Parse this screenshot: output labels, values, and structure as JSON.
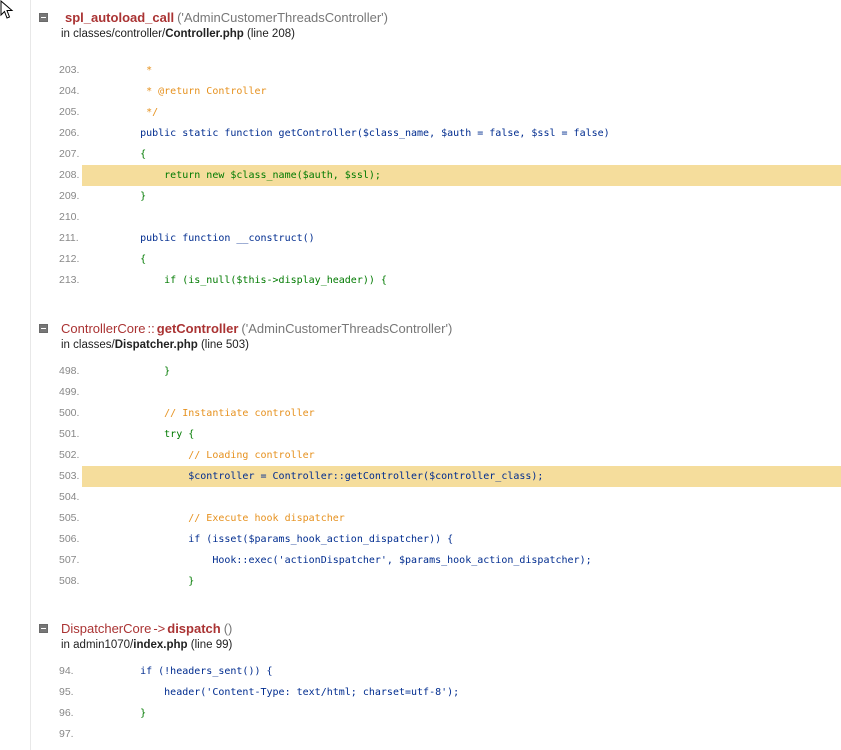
{
  "frames": [
    {
      "class": "",
      "operator": "",
      "function": "spl_autoload_call",
      "args": "('AdminCustomerThreadsController')",
      "location_prefix": "in ",
      "dir": "classes/controller/",
      "file": "Controller.php",
      "line_info": " (line 208)",
      "lines": [
        {
          "no": "203.",
          "code": "     *",
          "type": "com"
        },
        {
          "no": "204.",
          "code": "     * @return Controller",
          "type": "com"
        },
        {
          "no": "205.",
          "code": "     */",
          "type": "com"
        },
        {
          "no": "206.",
          "code": "    public static function getController($class_name, $auth = false, $ssl = false)",
          "type": "def"
        },
        {
          "no": "207.",
          "code": "    {",
          "type": "kw"
        },
        {
          "no": "208.",
          "code": "        return new $class_name($auth, $ssl);",
          "type": "kw",
          "highlight": true
        },
        {
          "no": "209.",
          "code": "    }",
          "type": "kw"
        },
        {
          "no": "210.",
          "code": "",
          "type": "kw"
        },
        {
          "no": "211.",
          "code": "    public function __construct()",
          "type": "def"
        },
        {
          "no": "212.",
          "code": "    {",
          "type": "kw"
        },
        {
          "no": "213.",
          "code": "        if (is_null($this->display_header)) {",
          "type": "kw"
        }
      ]
    },
    {
      "class": "ControllerCore",
      "operator": "::",
      "function": "getController",
      "args": "('AdminCustomerThreadsController')",
      "location_prefix": "in ",
      "dir": "classes/",
      "file": "Dispatcher.php",
      "line_info": " (line 503)",
      "lines": [
        {
          "no": "498.",
          "code": "        }",
          "type": "kw"
        },
        {
          "no": "499.",
          "code": "",
          "type": "kw"
        },
        {
          "no": "500.",
          "code": "        // Instantiate controller",
          "type": "com"
        },
        {
          "no": "501.",
          "code": "        try {",
          "type": "kw"
        },
        {
          "no": "502.",
          "code": "            // Loading controller",
          "type": "com"
        },
        {
          "no": "503.",
          "code": "            $controller = Controller::getController($controller_class);",
          "type": "def",
          "highlight": true
        },
        {
          "no": "504.",
          "code": "",
          "type": "kw"
        },
        {
          "no": "505.",
          "code": "            // Execute hook dispatcher",
          "type": "com"
        },
        {
          "no": "506.",
          "code": "            if (isset($params_hook_action_dispatcher)) {",
          "type": "def"
        },
        {
          "no": "507.",
          "code": "                Hook::exec('actionDispatcher', $params_hook_action_dispatcher);",
          "type": "def"
        },
        {
          "no": "508.",
          "code": "            }",
          "type": "kw"
        }
      ]
    },
    {
      "class": "DispatcherCore",
      "operator": "->",
      "function": "dispatch",
      "args": "()",
      "location_prefix": "in ",
      "dir": "admin1070/",
      "file": "index.php",
      "line_info": " (line 99)",
      "lines": [
        {
          "no": "94.",
          "code": "    if (!headers_sent()) {",
          "type": "def"
        },
        {
          "no": "95.",
          "code": "        header('Content-Type: text/html; charset=utf-8');",
          "type": "def"
        },
        {
          "no": "96.",
          "code": "    }",
          "type": "kw"
        },
        {
          "no": "97.",
          "code": "",
          "type": "kw"
        }
      ]
    }
  ]
}
